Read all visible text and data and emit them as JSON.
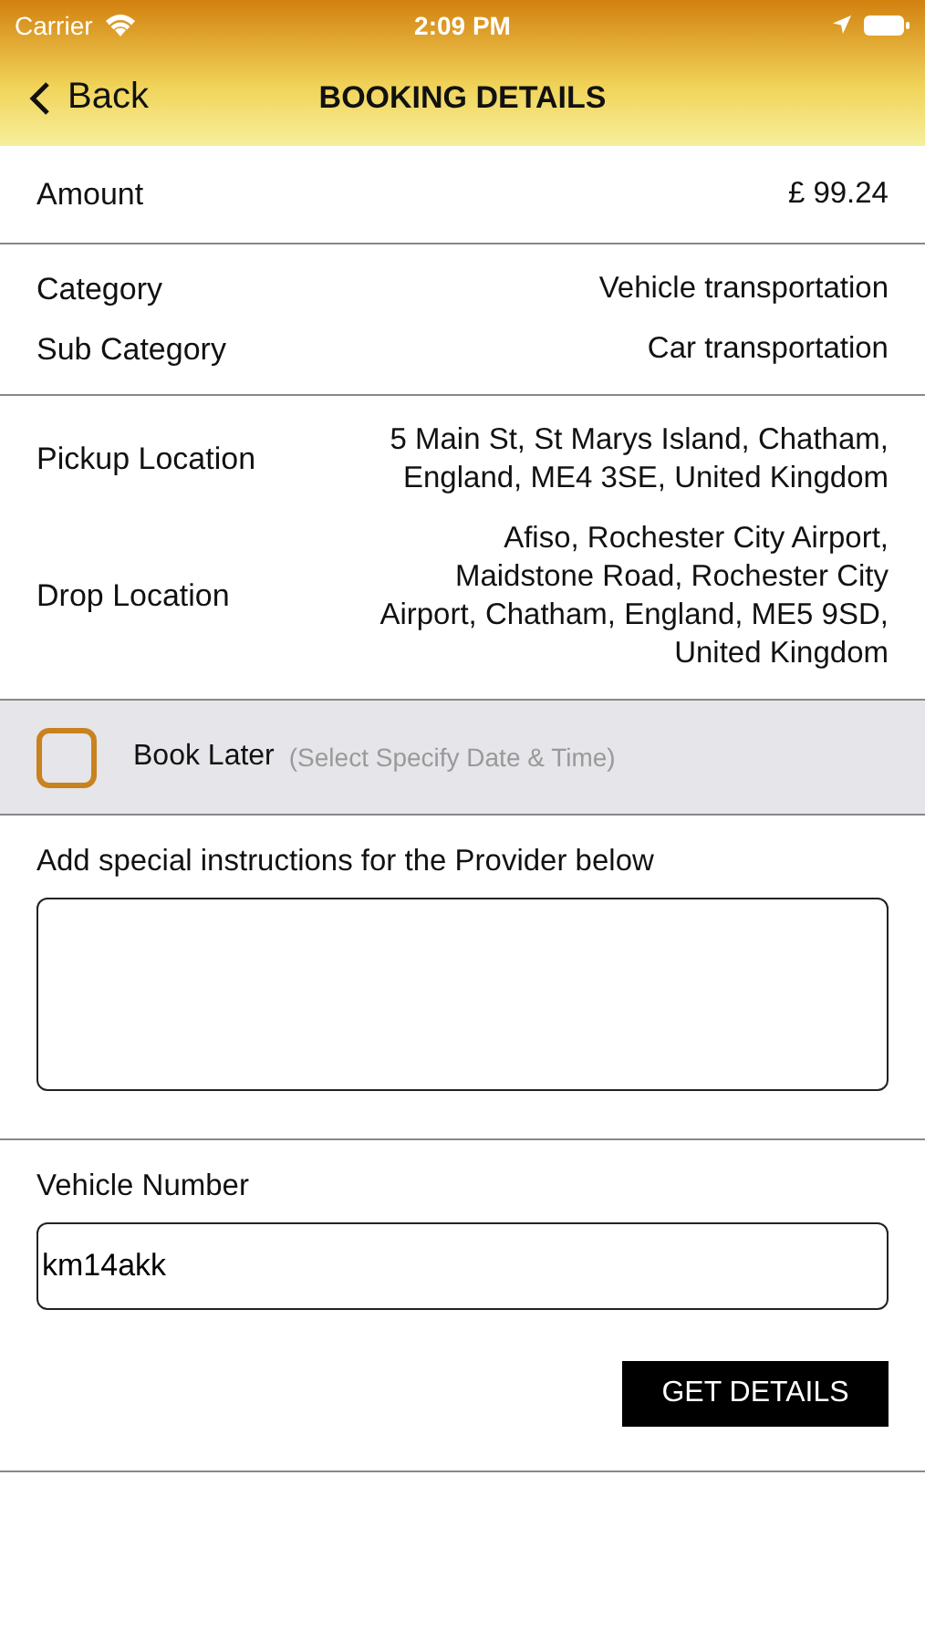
{
  "status_bar": {
    "carrier": "Carrier",
    "time": "2:09 PM"
  },
  "nav": {
    "back": "Back",
    "title": "BOOKING DETAILS"
  },
  "sections": [
    {
      "rows": [
        {
          "label": "Amount",
          "value": "£ 99.24"
        }
      ]
    },
    {
      "rows": [
        {
          "label": "Category",
          "value": "Vehicle transportation"
        },
        {
          "label": "Sub Category",
          "value": "Car transportation"
        }
      ]
    },
    {
      "rows": [
        {
          "label": "Pickup Location",
          "value": "5 Main St, St Marys Island, Chatham, England, ME4 3SE, United Kingdom"
        },
        {
          "label": "Drop Location",
          "value": "Afiso, Rochester City Airport, Maidstone Road, Rochester City Airport, Chatham, England, ME5 9SD, United Kingdom"
        }
      ]
    }
  ],
  "book_later": {
    "checked": false,
    "label": "Book Later",
    "hint": "(Select Specify Date & Time)"
  },
  "instructions": {
    "label": "Add special instructions for the Provider below"
  },
  "vehicle": {
    "label": "Vehicle Number",
    "value": "km14akk"
  },
  "button": "GET DETAILS"
}
